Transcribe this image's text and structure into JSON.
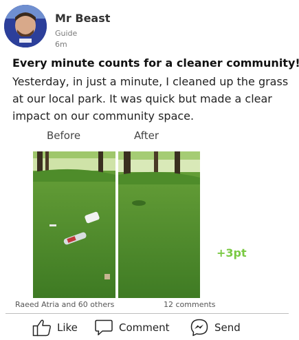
{
  "post": {
    "author": "Mr Beast",
    "role": "Guide",
    "time": "6m",
    "headline": "Every minute counts for a cleaner community!",
    "body": "Yesterday, in just a minute, I cleaned up the grass at our local park. It was quick but made a clear impact on our community space.",
    "before_label": "Before",
    "after_label": "After",
    "points": "+3pt",
    "likes_text": "Raeed Atria and 60  others",
    "comments_text": "12 comments"
  },
  "actions": {
    "like": "Like",
    "comment": "Comment",
    "send": "Send"
  },
  "colors": {
    "points": "#7ac943",
    "grass": "#4f8a2b"
  },
  "icons": [
    "thumbs-up-icon",
    "comment-icon",
    "messenger-icon"
  ]
}
